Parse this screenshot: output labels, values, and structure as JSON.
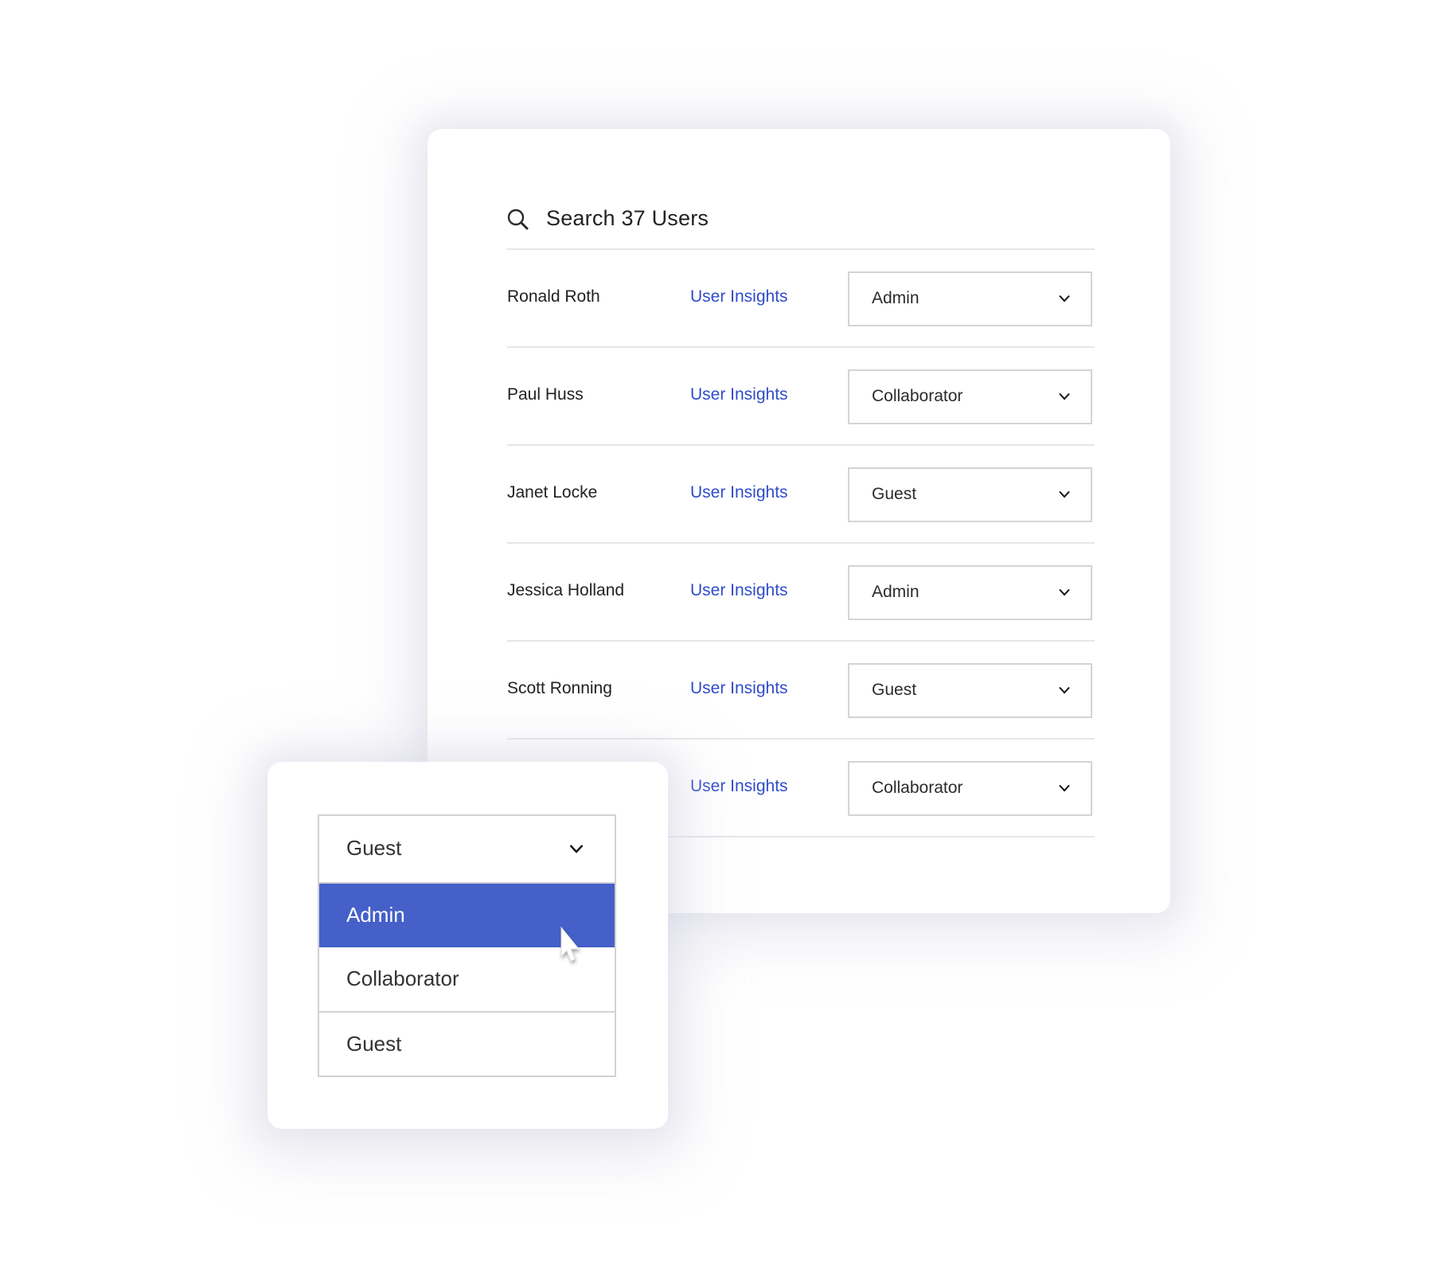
{
  "search": {
    "icon": "search-icon",
    "placeholder": "Search 37 Users"
  },
  "users": [
    {
      "name": "Ronald Roth",
      "link": "User Insights",
      "role": "Admin"
    },
    {
      "name": "Paul Huss",
      "link": "User Insights",
      "role": "Collaborator"
    },
    {
      "name": "Janet Locke",
      "link": "User Insights",
      "role": "Guest"
    },
    {
      "name": "Jessica Holland",
      "link": "User Insights",
      "role": "Admin"
    },
    {
      "name": "Scott Ronning",
      "link": "User Insights",
      "role": "Guest"
    },
    {
      "name": "",
      "link": "User Insights",
      "role": "Collaborator"
    }
  ],
  "role_dropdown": {
    "selected": "Guest",
    "options": [
      {
        "label": "Admin",
        "highlighted": true
      },
      {
        "label": "Collaborator",
        "highlighted": false
      },
      {
        "label": "Guest",
        "highlighted": false
      }
    ]
  },
  "colors": {
    "link": "#2f4cc9",
    "highlight": "#4560c8",
    "border": "#d4d4d6",
    "divider": "#e6e6e9"
  }
}
